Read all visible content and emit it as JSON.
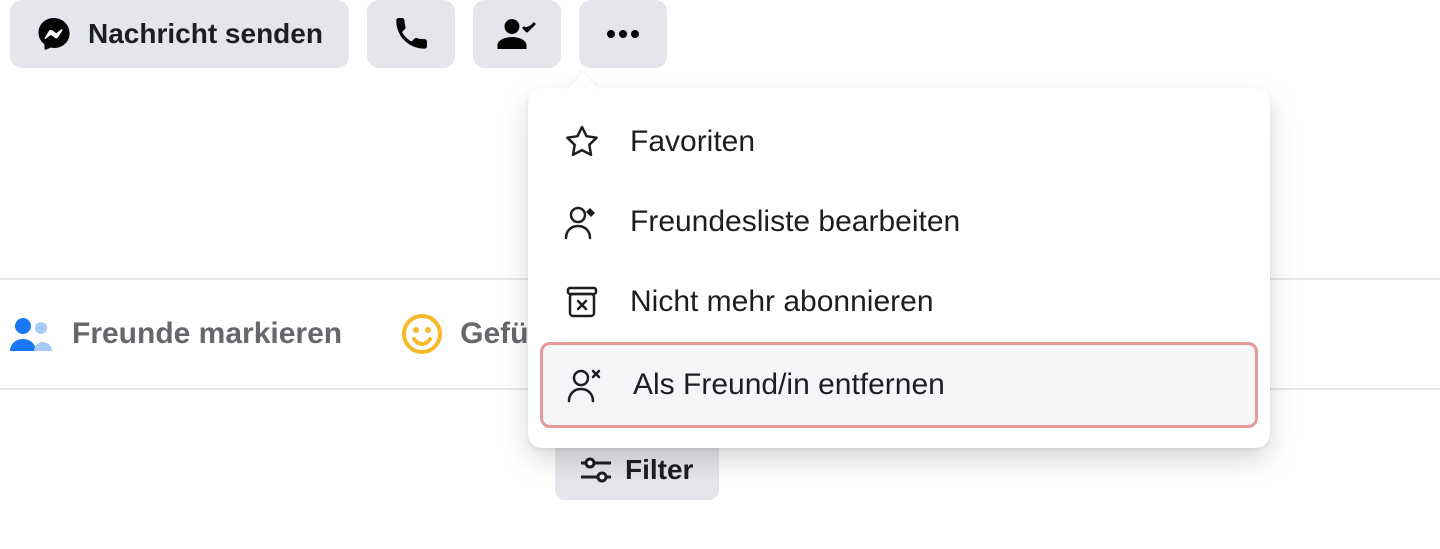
{
  "toolbar": {
    "message_label": "Nachricht senden"
  },
  "post_actions": {
    "tag_friends": "Freunde markieren",
    "feeling_activity_prefix": "Gefü"
  },
  "filter_label": "Filter",
  "friend_menu": {
    "items": [
      {
        "label": "Favoriten"
      },
      {
        "label": "Freundesliste bearbeiten"
      },
      {
        "label": "Nicht mehr abonnieren"
      },
      {
        "label": "Als Freund/in entfernen"
      }
    ]
  }
}
